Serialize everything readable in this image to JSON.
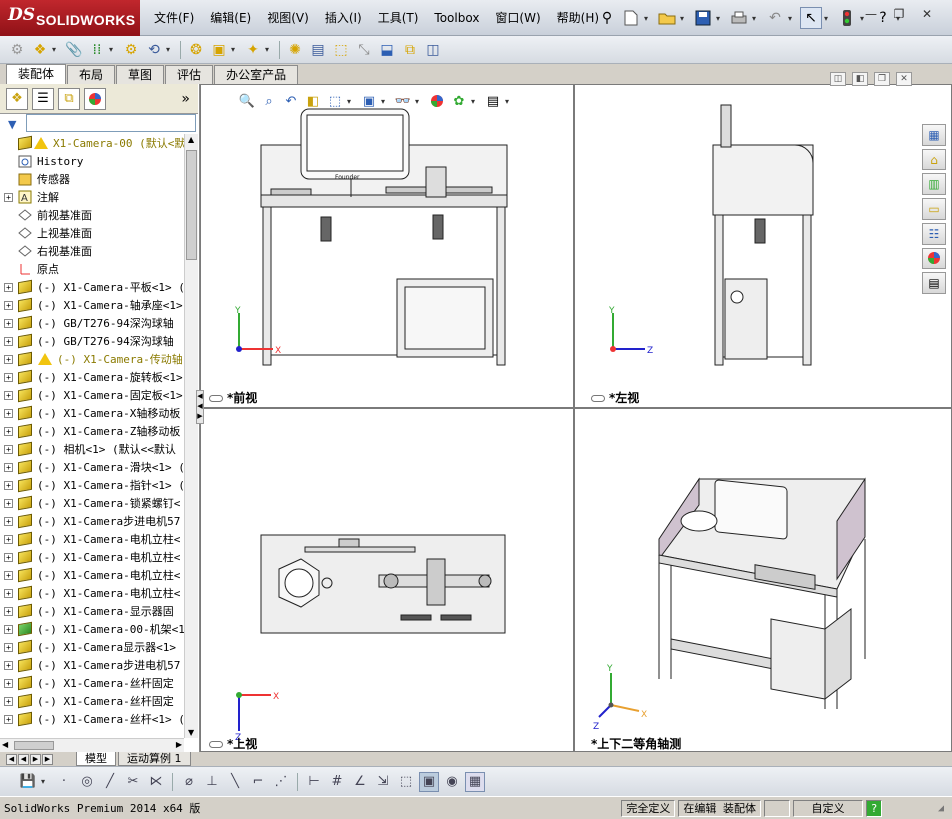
{
  "app": {
    "logo_ds": "DS",
    "logo_text": "SOLIDWORKS"
  },
  "menu": [
    "文件(F)",
    "编辑(E)",
    "视图(V)",
    "插入(I)",
    "工具(T)",
    "Toolbox",
    "窗口(W)",
    "帮助(H)"
  ],
  "command_tabs": [
    "装配体",
    "布局",
    "草图",
    "评估",
    "办公室产品"
  ],
  "feature_tree": {
    "root": "X1-Camera-00  (默认<默认",
    "items": [
      {
        "label": "History",
        "icon": "history-icon",
        "expand": false
      },
      {
        "label": "传感器",
        "icon": "sensor-icon",
        "expand": false
      },
      {
        "label": "注解",
        "icon": "annotation-icon",
        "expand": true
      },
      {
        "label": "前视基准面",
        "icon": "plane-icon",
        "expand": false
      },
      {
        "label": "上视基准面",
        "icon": "plane-icon",
        "expand": false
      },
      {
        "label": "右视基准面",
        "icon": "plane-icon",
        "expand": false
      },
      {
        "label": "原点",
        "icon": "origin-icon",
        "expand": false
      },
      {
        "label": "(-) X1-Camera-平板<1> (",
        "icon": "component-icon",
        "expand": true
      },
      {
        "label": "(-) X1-Camera-轴承座<1>",
        "icon": "component-icon",
        "expand": true
      },
      {
        "label": "(-) GB/T276-94深沟球轴",
        "icon": "component-icon",
        "expand": true
      },
      {
        "label": "(-) GB/T276-94深沟球轴",
        "icon": "component-icon",
        "expand": true
      },
      {
        "label": "(-) X1-Camera-传动轴",
        "icon": "component-warn-icon",
        "expand": true,
        "warn": true
      },
      {
        "label": "(-) X1-Camera-旋转板<1>",
        "icon": "component-icon",
        "expand": true
      },
      {
        "label": "(-) X1-Camera-固定板<1>",
        "icon": "component-icon",
        "expand": true
      },
      {
        "label": "(-) X1-Camera-X轴移动板",
        "icon": "component-icon",
        "expand": true
      },
      {
        "label": "(-) X1-Camera-Z轴移动板",
        "icon": "component-icon",
        "expand": true
      },
      {
        "label": "(-) 相机<1> (默认<<默认",
        "icon": "component-icon",
        "expand": true
      },
      {
        "label": "(-) X1-Camera-滑块<1> (",
        "icon": "component-icon",
        "expand": true
      },
      {
        "label": "(-) X1-Camera-指针<1> (",
        "icon": "component-icon",
        "expand": true
      },
      {
        "label": "(-) X1-Camera-锁紧螺钉<",
        "icon": "component-icon",
        "expand": true
      },
      {
        "label": "(-) X1-Camera步进电机57",
        "icon": "component-icon",
        "expand": true
      },
      {
        "label": "(-) X1-Camera-电机立柱<",
        "icon": "component-icon",
        "expand": true
      },
      {
        "label": "(-) X1-Camera-电机立柱<",
        "icon": "component-icon",
        "expand": true
      },
      {
        "label": "(-) X1-Camera-电机立柱<",
        "icon": "component-icon",
        "expand": true
      },
      {
        "label": "(-) X1-Camera-电机立柱<",
        "icon": "component-icon",
        "expand": true
      },
      {
        "label": "(-) X1-Camera-显示器固",
        "icon": "component-icon",
        "expand": true
      },
      {
        "label": "(-) X1-Camera-00-机架<1",
        "icon": "subassembly-icon",
        "expand": true
      },
      {
        "label": "(-) X1-Camera显示器<1>",
        "icon": "component-icon",
        "expand": true
      },
      {
        "label": "(-) X1-Camera步进电机57",
        "icon": "component-icon",
        "expand": true
      },
      {
        "label": "(-) X1-Camera-丝杆固定",
        "icon": "component-icon",
        "expand": true
      },
      {
        "label": "(-) X1-Camera-丝杆固定",
        "icon": "component-icon",
        "expand": true
      },
      {
        "label": "(-) X1-Camera-丝杆<1> (",
        "icon": "component-icon",
        "expand": true
      }
    ]
  },
  "bottom_tabs": [
    "模型",
    "运动算例 1"
  ],
  "views": {
    "front": "*前视",
    "left": "*左视",
    "top": "*上视",
    "iso": "*上下二等角轴测"
  },
  "axes": {
    "x": "X",
    "y": "Y",
    "z": "Z"
  },
  "monitor_brand": "Founder",
  "status": {
    "product": "SolidWorks Premium 2014 x64 版",
    "defined": "完全定义",
    "editing": "在编辑 装配体",
    "custom": "自定义"
  }
}
